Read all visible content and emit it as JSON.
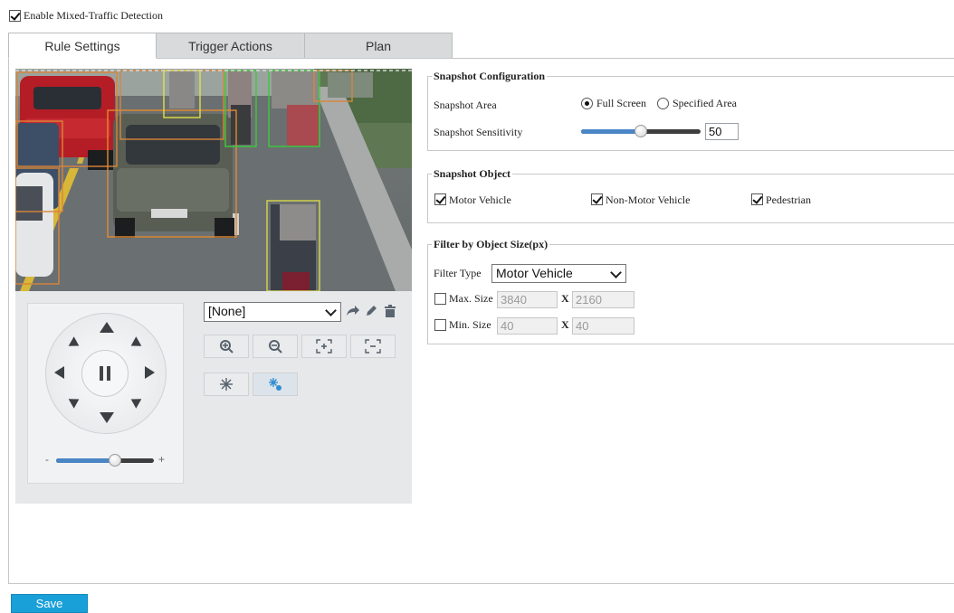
{
  "enable_detection": {
    "label": "Enable Mixed-Traffic Detection",
    "checked": true
  },
  "tabs": [
    {
      "label": "Rule Settings",
      "active": true
    },
    {
      "label": "Trigger Actions",
      "active": false
    },
    {
      "label": "Plan",
      "active": false
    }
  ],
  "ptz": {
    "preset_value": "[None]",
    "icons": [
      "goto-preset-icon",
      "edit-preset-icon",
      "delete-preset-icon",
      "zoom-in-icon",
      "zoom-out-icon",
      "focus-near-icon",
      "focus-far-icon",
      "wiper-icon",
      "light-icon"
    ],
    "speed_minus": "-",
    "speed_plus": "+",
    "speed_level": 0.5
  },
  "snapshot_config": {
    "legend": "Snapshot Configuration",
    "area_label": "Snapshot Area",
    "area_options": [
      {
        "label": "Full Screen",
        "selected": true
      },
      {
        "label": "Specified Area",
        "selected": false
      }
    ],
    "sensitivity_label": "Snapshot Sensitivity",
    "sensitivity_value": "50",
    "sensitivity_level": 0.5
  },
  "snapshot_object": {
    "legend": "Snapshot Object",
    "options": [
      {
        "label": "Motor Vehicle",
        "checked": true
      },
      {
        "label": "Non-Motor Vehicle",
        "checked": true
      },
      {
        "label": "Pedestrian",
        "checked": true
      }
    ]
  },
  "filter": {
    "legend": "Filter by Object Size(px)",
    "type_label": "Filter Type",
    "type_value": "Motor Vehicle",
    "max": {
      "label": "Max. Size",
      "w": "3840",
      "x": "X",
      "h": "2160",
      "checked": false
    },
    "min": {
      "label": "Min. Size",
      "w": "40",
      "x": "X",
      "h": "40",
      "checked": false
    }
  },
  "save_label": "Save",
  "colors": {
    "accent": "#1aa0d8",
    "slider": "#4a86c5",
    "tab_inactive": "#d9dadb",
    "panel": "#e6e8ea"
  }
}
